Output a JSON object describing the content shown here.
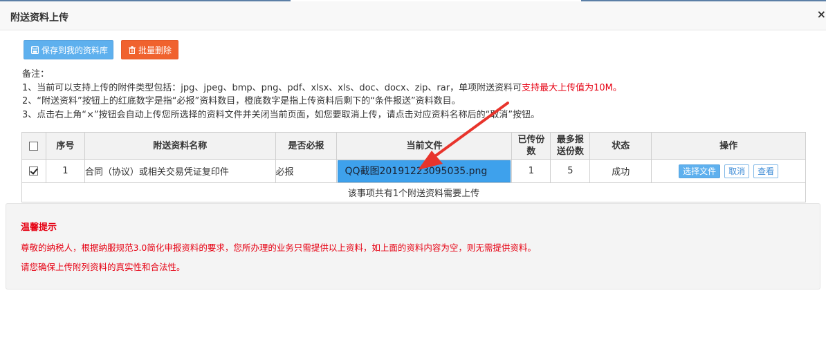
{
  "header": {
    "title": "附送资料上传",
    "close_glyph": "×"
  },
  "toolbar": {
    "save_label": "保存到我的资料库",
    "save_icon": "save-icon",
    "delete_label": "批量删除",
    "delete_icon": "trash-icon"
  },
  "notes": {
    "heading": "备注：",
    "line1_prefix": "1、当前可以支持上传的附件类型包括：jpg、jpeg、bmp、png、pdf、xlsx、xls、doc、docx、zip、rar，单项附送资料可",
    "line1_red": "支持最大上传值为10M。",
    "line2": "2、“附送资料”按钮上的红底数字是指“必报”资料数目，橙底数字是指上传资料后剩下的“条件报送”资料数目。",
    "line3": "3、点击右上角“×”按钮会自动上传您所选择的资料文件并关闭当前页面，如您要取消上传，请点击对应资料名称后的“取消”按钮。"
  },
  "table": {
    "headers": {
      "index": "序号",
      "name": "附送资料名称",
      "required": "是否必报",
      "file": "当前文件",
      "uploaded_line1": "已传份",
      "uploaded_line2": "数",
      "max_line1": "最多报",
      "max_line2": "送份数",
      "status": "状态",
      "actions": "操作"
    },
    "rows": [
      {
        "checked": true,
        "index": "1",
        "name": "合同（协议）或相关交易凭证复印件",
        "required": "必报",
        "file": "QQ截图20191223095035.png",
        "uploaded": "1",
        "max": "5",
        "status": "成功",
        "action_select": "选择文件",
        "action_cancel": "取消",
        "action_view": "查看"
      }
    ],
    "footer": "该事项共有1个附送资料需要上传"
  },
  "tips": {
    "title": "温馨提示",
    "line1": "尊敬的纳税人，根据纳服规范3.0简化申报资料的要求，您所办理的业务只需提供以上资料，如上面的资料内容为空，则无需提供资料。",
    "line2": "请您确保上传附列资料的真实性和合法性。"
  },
  "colors": {
    "accent_blue": "#5eb0ee",
    "danger_orange": "#f0622e",
    "warning_red": "#e60012",
    "file_highlight": "#3ea1ec",
    "annotation_arrow": "#e8342c"
  }
}
